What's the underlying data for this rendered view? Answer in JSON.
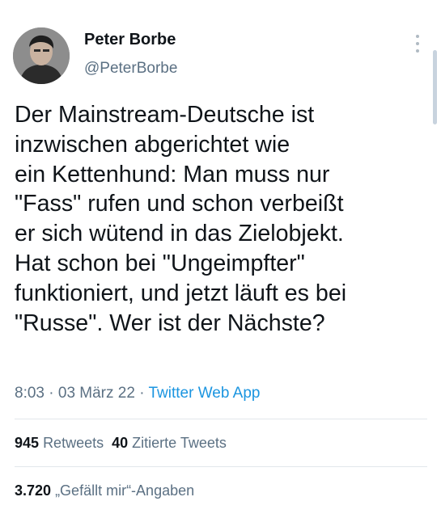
{
  "author": {
    "name": "Peter Borbe",
    "handle": "@PeterBorbe"
  },
  "tweet": {
    "text": "Der Mainstream-Deutsche ist\ninzwischen abgerichtet wie\nein Kettenhund: Man muss nur\n\"Fass\" rufen und schon verbeißt\ner sich wütend in das Zielobjekt.\nHat schon bei \"Ungeimpfter\"\nfunktioniert, und jetzt läuft es bei\n\"Russe\". Wer ist der Nächste?"
  },
  "meta": {
    "time": "8:03",
    "separator": " · ",
    "date": "03 März 22",
    "source": "Twitter Web App"
  },
  "stats": {
    "retweets_count": "945",
    "retweets_label": "Retweets",
    "quotes_count": "40",
    "quotes_label": "Zitierte Tweets",
    "likes_count": "3.720",
    "likes_label": "„Gefällt mir“-Angaben"
  },
  "icons": {
    "more": "more-vertical-icon"
  },
  "colors": {
    "text": "#0f1419",
    "secondary": "#5b7083",
    "link": "#1b95e0",
    "divider": "#e2e7eb"
  }
}
